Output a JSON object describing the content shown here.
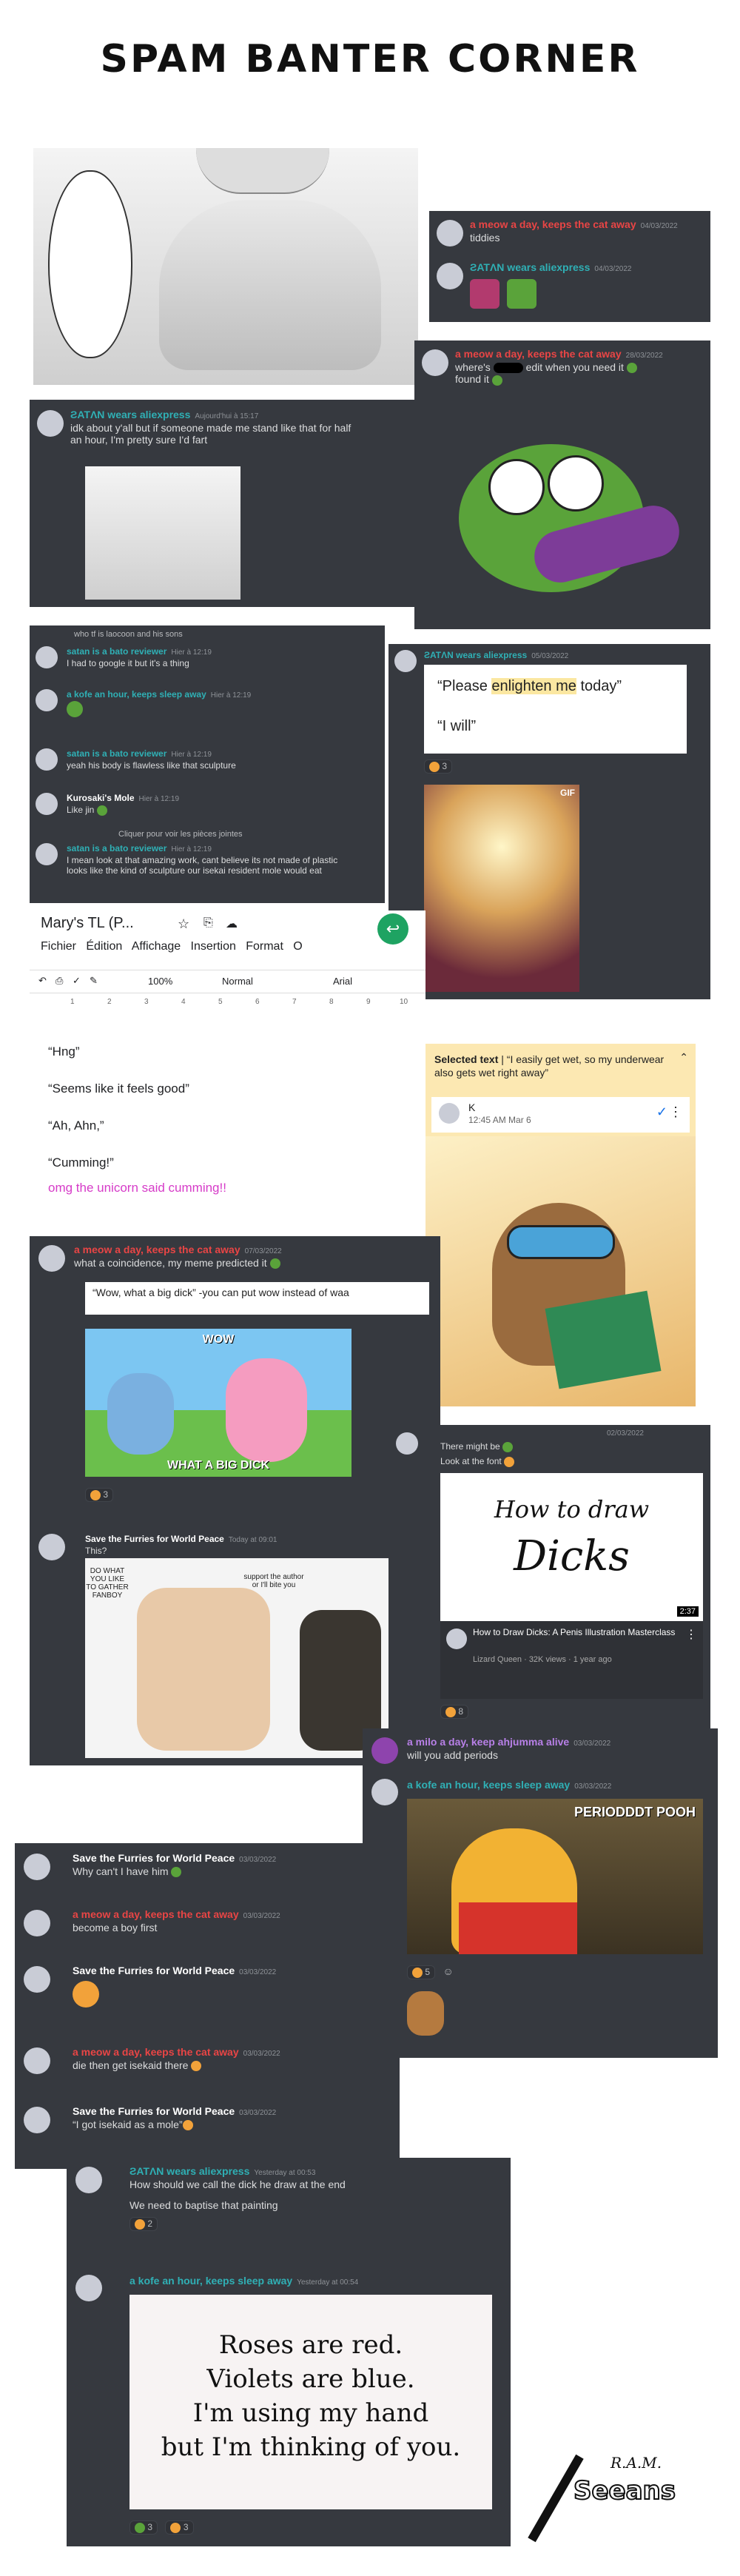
{
  "page": {
    "title": "SPAM BANTER CORNER"
  },
  "panel1": {
    "messages": [
      {
        "user": "a meow a day, keeps the cat away",
        "time": "04/03/2022",
        "text": "tiddies"
      },
      {
        "user": "ƧATΛN wears aliexpress",
        "time": "04/03/2022",
        "text": ""
      }
    ]
  },
  "panel2": {
    "user": "ƧATΛN wears aliexpress",
    "time": "Aujourd'hui à 15:17",
    "text1": "idk about y'all but if someone made me stand like that for half",
    "text2": "an hour, I'm pretty sure I'd fart"
  },
  "panel3": {
    "user": "a meow a day, keeps the cat away",
    "time": "28/03/2022",
    "text1": "where's",
    "text1b": "edit when you need it",
    "text2": "found it"
  },
  "panel4": {
    "reply_line": "who tf is laocoon and his sons",
    "messages": [
      {
        "user": "satan is a bato reviewer",
        "time": "Hier à 12:19",
        "text": "I had to google it but it's a thing"
      },
      {
        "user": "a kofe an hour, keeps sleep away",
        "time": "Hier à 12:19",
        "text": ""
      },
      {
        "user": "satan is a bato reviewer",
        "time": "Hier à 12:19",
        "text": "yeah his body is flawless like that sculpture"
      },
      {
        "user": "Kurosaki's Mole",
        "time": "Hier à 12:19",
        "text": "Like jin"
      },
      {
        "user": "satan is a bato reviewer",
        "time": "Hier à 12:19",
        "text": "I mean look at that amazing work, cant believe its not made of plastic"
      },
      {
        "user": "",
        "time": "",
        "text": "looks like the kind of sculpture our isekai resident mole would eat"
      }
    ],
    "attachment_line": "Cliquer pour voir les pièces jointes"
  },
  "panel5": {
    "user": "ƧATΛN wears aliexpress",
    "time": "05/03/2022",
    "quote1": "“Please ",
    "highlight": "enlighten me",
    "quote1b": " today”",
    "quote2": "“I will”",
    "reaction_count": "3",
    "gif_label": "GIF"
  },
  "gdoc": {
    "doc_title": "Mary's TL (P...",
    "menu": [
      "Fichier",
      "Édition",
      "Affichage",
      "Insertion",
      "Format",
      "O"
    ],
    "zoom": "100%",
    "style": "Normal",
    "font": "Arial",
    "ruler": [
      "1",
      "2",
      "3",
      "4",
      "5",
      "6",
      "7",
      "8",
      "9",
      "10"
    ],
    "lines": [
      "“Hng”",
      "“Seems like it feels good”",
      "“Ah, Ahn,”",
      "“Cumming!”"
    ],
    "pink_line": "omg the unicorn said cumming!!"
  },
  "comment": {
    "selected_label": "Selected text",
    "selected_text": "“I easily get wet, so my underwear also gets wet right away”",
    "user": "K",
    "time": "12:45 AM Mar 6"
  },
  "panel6": {
    "user": "a meow a day, keeps the cat away",
    "time": "07/03/2022",
    "text": "what a coincidence, my meme predicted it",
    "quote": "“Wow, what a big dick” -you can put wow instead of waa",
    "meme_top": "WOW",
    "meme_bottom": "WHAT A BIG DICK",
    "reaction_count": "3"
  },
  "panel7": {
    "user": "Save the Furries for World Peace",
    "time": "Today at 09:01",
    "text": "This?",
    "bubble1": "DO WHAT YOU LIKE TO GATHER FANBOY",
    "bubble2": "support the author or I'll bite you"
  },
  "panel8": {
    "date": "02/03/2022",
    "text1": "There might be",
    "text2": "Look at the font",
    "yt_title1": "How to draw",
    "yt_title2": "Dicks",
    "duration": "2:37",
    "video_title": "How to Draw Dicks: A Penis Illustration Masterclass",
    "channel": "Lizard Queen · 32K views · 1 year ago",
    "reaction_count": "8"
  },
  "panel9": {
    "messages": [
      {
        "user": "a milo a day, keep ahjumma alive",
        "time": "03/03/2022",
        "text": "will you add periods"
      },
      {
        "user": "a kofe an hour, keeps sleep away",
        "time": "03/03/2022",
        "text": ""
      }
    ],
    "meme_text": "PERIODDDT POOH",
    "reaction_count": "5"
  },
  "panel10": {
    "messages": [
      {
        "user": "Save the Furries for World Peace",
        "time": "03/03/2022",
        "text": "Why can't I have him"
      },
      {
        "user": "a meow a day, keeps the cat away",
        "time": "03/03/2022",
        "text": "become a boy first"
      },
      {
        "user": "Save the Furries for World Peace",
        "time": "03/03/2022",
        "text": ""
      },
      {
        "user": "a meow a day, keeps the cat away",
        "time": "03/03/2022",
        "text": "die then get isekaid there"
      },
      {
        "user": "Save the Furries for World Peace",
        "time": "03/03/2022",
        "text": "“I got isekaid as a mole”"
      }
    ]
  },
  "panel11": {
    "messages": [
      {
        "user": "ƧATΛN wears aliexpress",
        "time": "Yesterday at 00:53",
        "text": "How should we call the dick he draw at the end"
      },
      {
        "user": "",
        "time": "",
        "text": "We need to baptise that painting"
      },
      {
        "user": "a kofe an hour, keeps sleep away",
        "time": "Yesterday at 00:54",
        "text": ""
      }
    ],
    "reaction_count": "2",
    "poem": [
      "Roses are red.",
      "Violets are blue.",
      "I'm using my hand",
      "but I'm thinking of you."
    ],
    "poem_reactions": [
      "3",
      "3"
    ]
  },
  "logo": {
    "text": "Seeans",
    "small": "R.A.M."
  }
}
